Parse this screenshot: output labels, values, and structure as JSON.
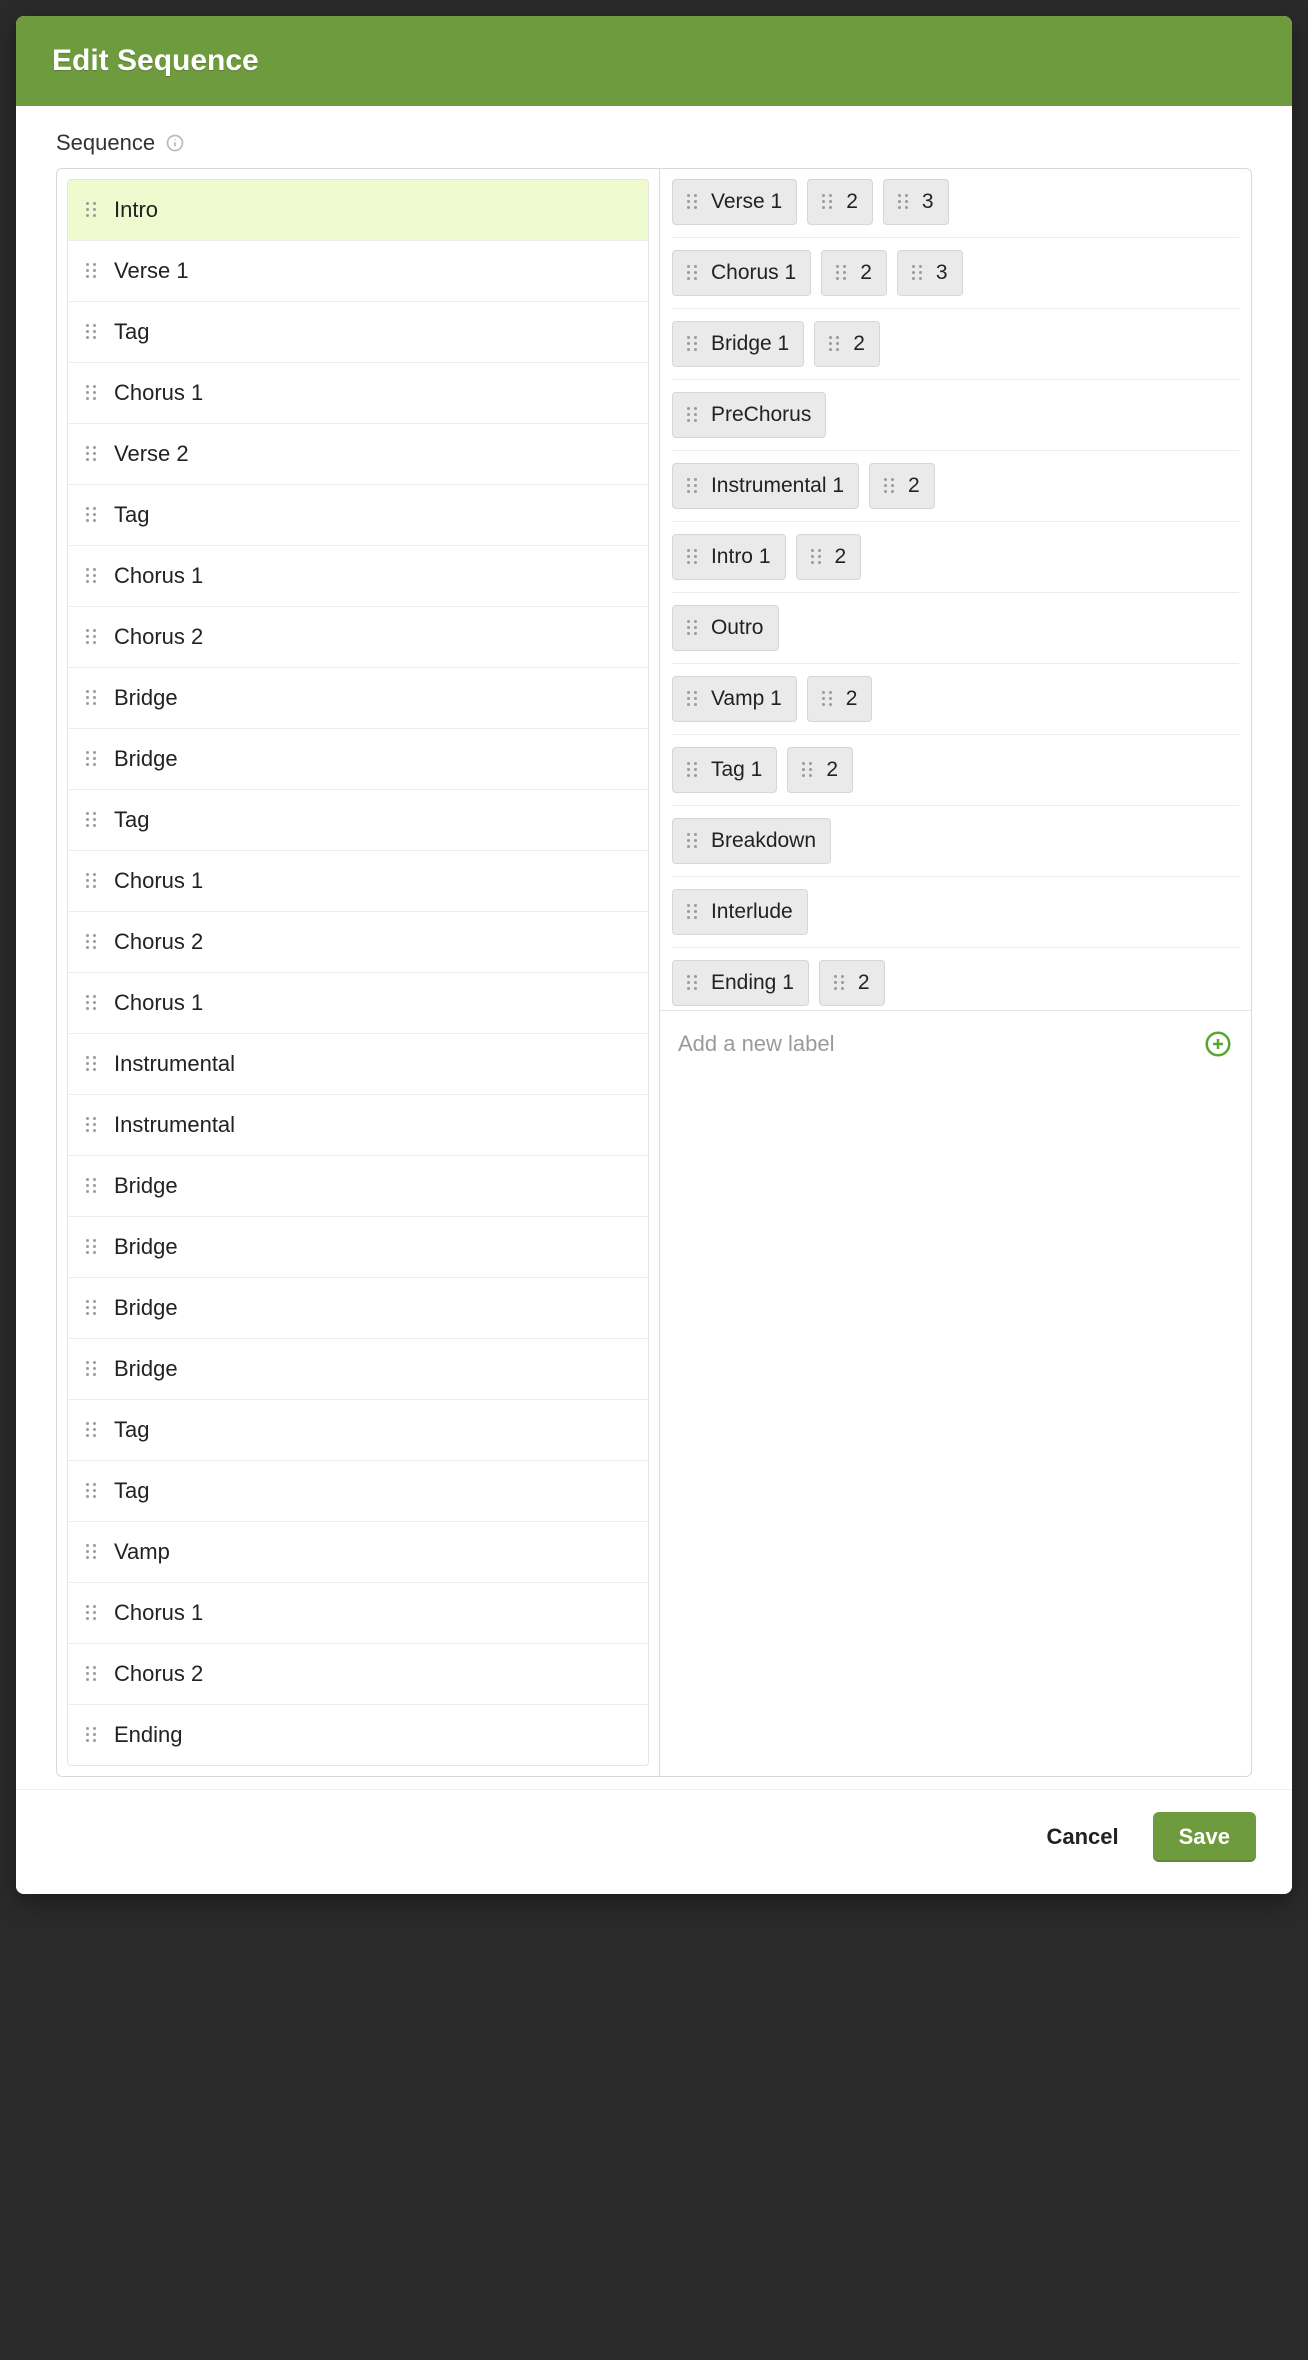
{
  "modal": {
    "title": "Edit Sequence"
  },
  "section_label": "Sequence",
  "add_label_placeholder": "Add a new label",
  "footer": {
    "cancel_label": "Cancel",
    "save_label": "Save"
  },
  "sequence": [
    {
      "label": "Intro",
      "active": true
    },
    {
      "label": "Verse 1"
    },
    {
      "label": "Tag"
    },
    {
      "label": "Chorus 1"
    },
    {
      "label": "Verse 2"
    },
    {
      "label": "Tag"
    },
    {
      "label": "Chorus 1"
    },
    {
      "label": "Chorus 2"
    },
    {
      "label": "Bridge"
    },
    {
      "label": "Bridge"
    },
    {
      "label": "Tag"
    },
    {
      "label": "Chorus 1"
    },
    {
      "label": "Chorus 2"
    },
    {
      "label": "Chorus 1"
    },
    {
      "label": "Instrumental"
    },
    {
      "label": "Instrumental"
    },
    {
      "label": "Bridge"
    },
    {
      "label": "Bridge"
    },
    {
      "label": "Bridge"
    },
    {
      "label": "Bridge"
    },
    {
      "label": "Tag"
    },
    {
      "label": "Tag"
    },
    {
      "label": "Vamp"
    },
    {
      "label": "Chorus 1"
    },
    {
      "label": "Chorus 2"
    },
    {
      "label": "Ending"
    }
  ],
  "palette": [
    [
      {
        "label": "Verse 1"
      },
      {
        "label": "2"
      },
      {
        "label": "3"
      }
    ],
    [
      {
        "label": "Chorus 1"
      },
      {
        "label": "2"
      },
      {
        "label": "3"
      }
    ],
    [
      {
        "label": "Bridge 1"
      },
      {
        "label": "2"
      }
    ],
    [
      {
        "label": "PreChorus"
      }
    ],
    [
      {
        "label": "Instrumental 1"
      },
      {
        "label": "2"
      }
    ],
    [
      {
        "label": "Intro 1"
      },
      {
        "label": "2"
      }
    ],
    [
      {
        "label": "Outro"
      }
    ],
    [
      {
        "label": "Vamp 1"
      },
      {
        "label": "2"
      }
    ],
    [
      {
        "label": "Tag 1"
      },
      {
        "label": "2"
      }
    ],
    [
      {
        "label": "Breakdown"
      }
    ],
    [
      {
        "label": "Interlude"
      }
    ],
    [
      {
        "label": "Ending 1"
      },
      {
        "label": "2"
      }
    ]
  ]
}
